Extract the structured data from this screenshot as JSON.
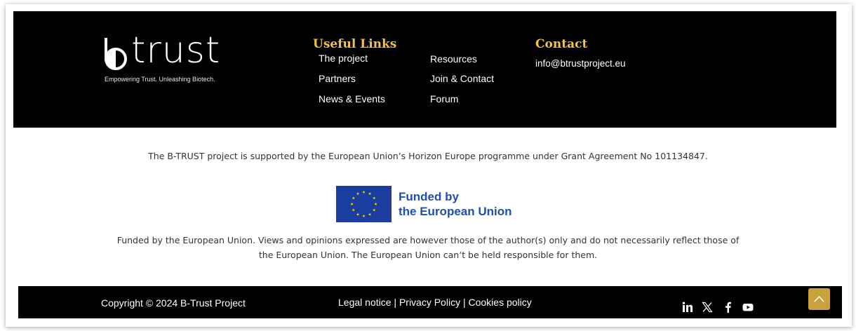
{
  "brand": {
    "logo_text": "trust",
    "tagline": "Empowering Trust. Unleashing Biotech."
  },
  "useful_links": {
    "title": "Useful Links",
    "col1": [
      "The project",
      "Partners",
      "News & Events"
    ],
    "col2": [
      "Resources",
      "Join & Contact",
      "Forum"
    ]
  },
  "contact": {
    "title": "Contact",
    "email": "info@btrustproject.eu"
  },
  "support": {
    "text": "The B-TRUST project is supported by the European Union’s Horizon Europe programme under Grant Agreement No  101134847."
  },
  "funding": {
    "line1": "Funded by",
    "line2": "the European Union",
    "disclaimer_line1": "Funded by the European Union. Views and opinions expressed are however those of the author(s) only and do not necessarily reflect those of",
    "disclaimer_line2": "the European Union. The European Union can’t be held responsible for them."
  },
  "bottom": {
    "copyright": "Copyright © 2024 B-Trust Project",
    "legal_notice": "Legal notice",
    "privacy_policy": "Privacy Policy",
    "cookies_policy": "Cookies policy",
    "separator": "|"
  },
  "social_icons": [
    "linkedin-icon",
    "x-icon",
    "facebook-icon",
    "youtube-icon"
  ],
  "colors": {
    "accent_gold": "#f2c14e",
    "eu_blue": "#1a3d9e",
    "eu_text_blue": "#1f4fa8",
    "scroll_button": "#c9a23d"
  }
}
